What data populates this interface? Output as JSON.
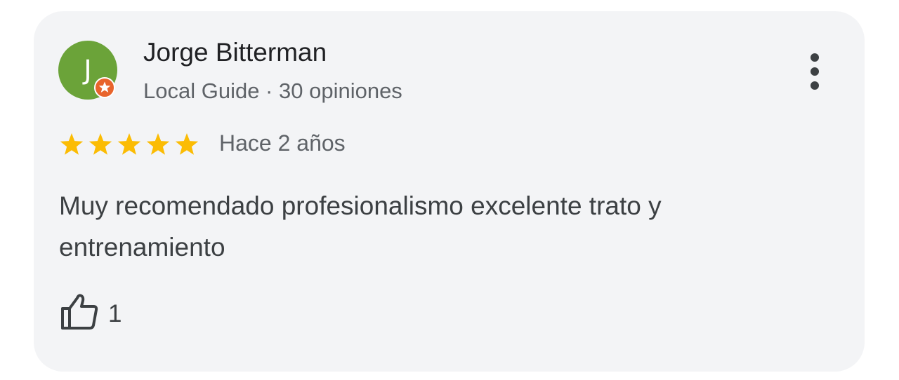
{
  "review": {
    "author": {
      "initial": "J",
      "name": "Jorge Bitterman",
      "meta": "Local Guide · 30 opiniones",
      "avatar_color": "#6ba339",
      "badge_icon": "local-guide-star-badge",
      "badge_color": "#e8642c"
    },
    "rating": 5,
    "rating_max": 5,
    "star_color": "#fbbc04",
    "date": "Hace 2 años",
    "text": "Muy recomendado profesionalismo excelente trato y entrenamiento",
    "likes": "1",
    "like_icon": "thumbs-up-icon",
    "menu_icon": "more-vertical-icon"
  }
}
